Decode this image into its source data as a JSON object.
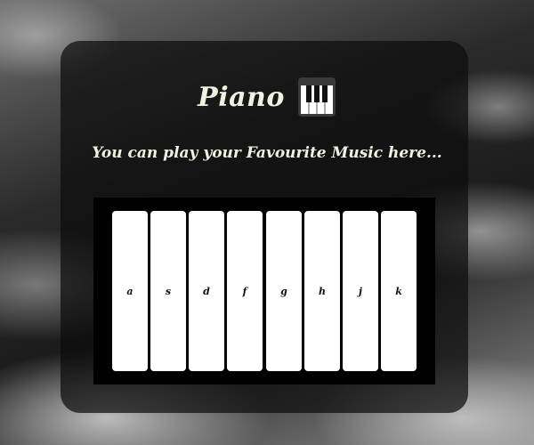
{
  "header": {
    "title": "Piano",
    "icon": "piano-keys-icon",
    "subtitle": "You can play your Favourite Music here..."
  },
  "keyboard": {
    "keys": [
      {
        "label": "a"
      },
      {
        "label": "s"
      },
      {
        "label": "d"
      },
      {
        "label": "f"
      },
      {
        "label": "g"
      },
      {
        "label": "h"
      },
      {
        "label": "j"
      },
      {
        "label": "k"
      }
    ]
  },
  "colors": {
    "title_text": "#f1f1e2",
    "card_bg": "#0c0c0c",
    "keyboard_bg": "#000000",
    "key_bg": "#ffffff"
  }
}
